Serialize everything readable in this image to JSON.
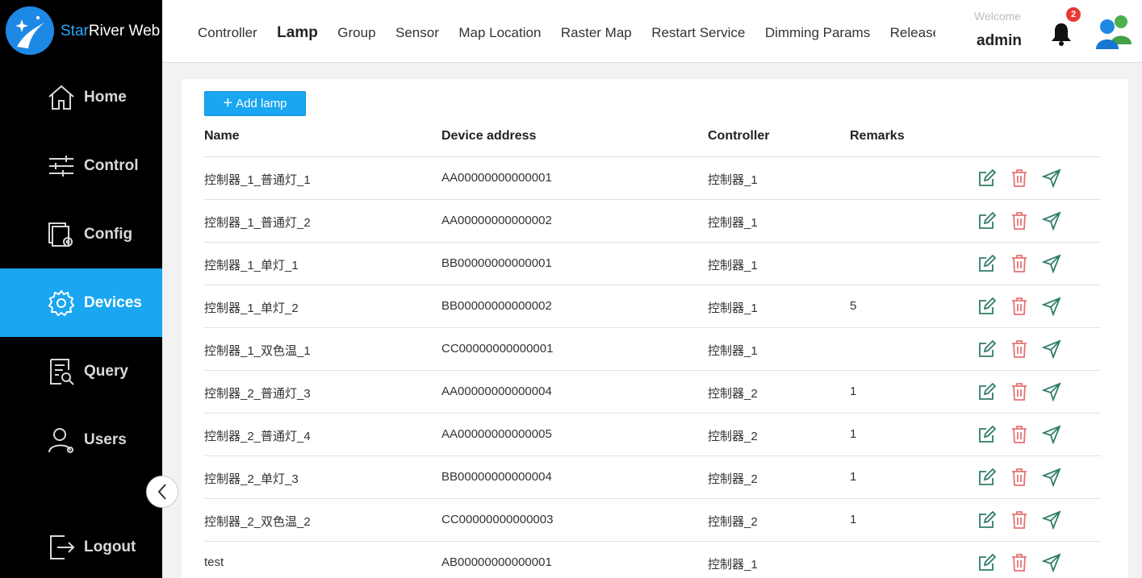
{
  "brand": {
    "name_part1": "Star",
    "name_part2": "River Web"
  },
  "sidebar": {
    "items": [
      {
        "label": "Home",
        "icon": "home-icon",
        "active": false
      },
      {
        "label": "Control",
        "icon": "sliders-icon",
        "active": false
      },
      {
        "label": "Config",
        "icon": "config-icon",
        "active": false
      },
      {
        "label": "Devices",
        "icon": "gear-icon",
        "active": true
      },
      {
        "label": "Query",
        "icon": "query-icon",
        "active": false
      },
      {
        "label": "Users",
        "icon": "user-icon",
        "active": false
      }
    ],
    "logout_label": "Logout"
  },
  "header": {
    "tabs": [
      "Controller",
      "Lamp",
      "Group",
      "Sensor",
      "Map Location",
      "Raster Map",
      "Restart Service",
      "Dimming Params",
      "Release Setti"
    ],
    "active_tab": "Lamp",
    "welcome": "Welcome",
    "username": "admin",
    "notification_count": "2"
  },
  "main": {
    "add_button_label": "Add lamp",
    "columns": [
      "Name",
      "Device address",
      "Controller",
      "Remarks"
    ],
    "rows": [
      {
        "name": "控制器_1_普通灯_1",
        "address": "AA00000000000001",
        "controller": "控制器_1",
        "remarks": ""
      },
      {
        "name": "控制器_1_普通灯_2",
        "address": "AA00000000000002",
        "controller": "控制器_1",
        "remarks": ""
      },
      {
        "name": "控制器_1_单灯_1",
        "address": "BB00000000000001",
        "controller": "控制器_1",
        "remarks": ""
      },
      {
        "name": "控制器_1_单灯_2",
        "address": "BB00000000000002",
        "controller": "控制器_1",
        "remarks": "5"
      },
      {
        "name": "控制器_1_双色温_1",
        "address": "CC00000000000001",
        "controller": "控制器_1",
        "remarks": ""
      },
      {
        "name": "控制器_2_普通灯_3",
        "address": "AA00000000000004",
        "controller": "控制器_2",
        "remarks": "1"
      },
      {
        "name": "控制器_2_普通灯_4",
        "address": "AA00000000000005",
        "controller": "控制器_2",
        "remarks": "1"
      },
      {
        "name": "控制器_2_单灯_3",
        "address": "BB00000000000004",
        "controller": "控制器_2",
        "remarks": "1"
      },
      {
        "name": "控制器_2_双色温_2",
        "address": "CC00000000000003",
        "controller": "控制器_2",
        "remarks": "1"
      },
      {
        "name": "test",
        "address": "AB00000000000001",
        "controller": "控制器_1",
        "remarks": ""
      }
    ]
  },
  "colors": {
    "accent": "#1aa6f0",
    "sidebar": "#000000",
    "edit": "#2e7d6a",
    "delete": "#e57373",
    "locate": "#2e7d6a",
    "badge": "#e53935"
  }
}
